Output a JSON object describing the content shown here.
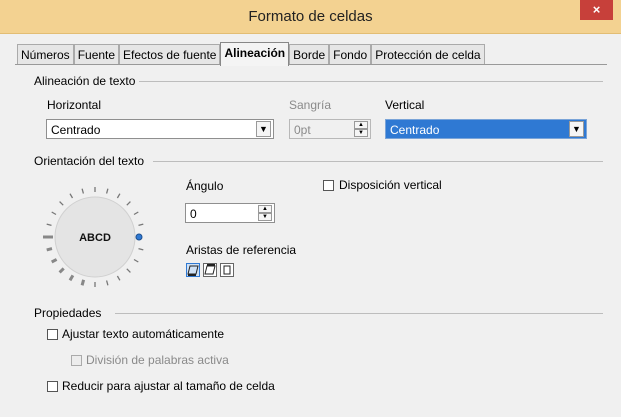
{
  "window": {
    "title": "Formato de celdas",
    "close_glyph": "×"
  },
  "tabs": [
    {
      "label": "Números"
    },
    {
      "label": "Fuente"
    },
    {
      "label": "Efectos de fuente"
    },
    {
      "label": "Alineación"
    },
    {
      "label": "Borde"
    },
    {
      "label": "Fondo"
    },
    {
      "label": "Protección de celda"
    }
  ],
  "text_alignment": {
    "section": "Alineación de texto",
    "horizontal_label": "Horizontal",
    "horizontal_value": "Centrado",
    "indent_label": "Sangría",
    "indent_value": "0pt",
    "vertical_label": "Vertical",
    "vertical_value": "Centrado"
  },
  "orientation": {
    "section": "Orientación del texto",
    "dial_text": "ABCD",
    "angle_label": "Ángulo",
    "angle_value": "0",
    "reference_edges_label": "Aristas de referencia",
    "vertical_layout_label": "Disposición vertical"
  },
  "properties": {
    "section": "Propiedades",
    "wrap_text": "Ajustar texto automáticamente",
    "hyphenation": "División de palabras activa",
    "shrink_to_fit": "Reducir para ajustar al tamaño de celda"
  },
  "colors": {
    "titlebar": "#f3d291",
    "close": "#c7403a",
    "selection": "#2f79d3"
  }
}
